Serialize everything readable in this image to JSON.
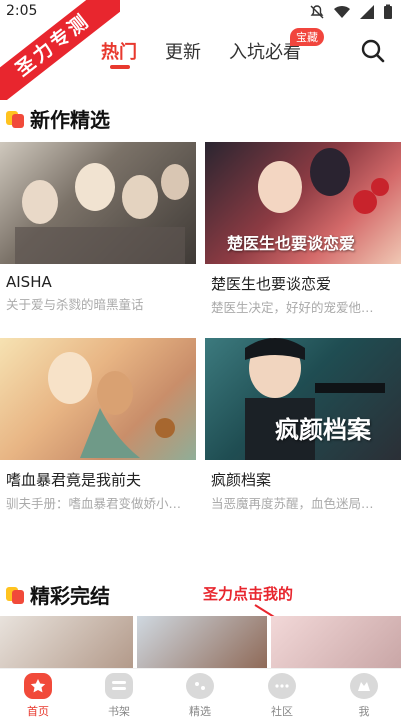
{
  "status": {
    "time": "2:05"
  },
  "ribbon": {
    "text": "圣力专测"
  },
  "topnav": {
    "tabs": [
      {
        "label": "热门",
        "active": true
      },
      {
        "label": "更新",
        "active": false
      },
      {
        "label": "入坑必看",
        "active": false,
        "badge": "宝藏"
      }
    ]
  },
  "section1": {
    "title": "新作精选",
    "items": [
      {
        "name": "AISHA",
        "desc": "关于爱与杀戮的暗黑童话"
      },
      {
        "name": "楚医生也要谈恋爱",
        "desc": "楚医生决定，好好的宠爱他…",
        "cover_text": "楚医生也要谈恋爱"
      },
      {
        "name": "嗜血暴君竟是我前夫",
        "desc": "驯夫手册：嗜血暴君变做娇小…"
      },
      {
        "name": "疯颜档案",
        "desc": "当恶魔再度苏醒，血色迷局…",
        "cover_text": "疯颜档案"
      }
    ]
  },
  "section2": {
    "title": "精彩完结"
  },
  "annotation": {
    "text": "圣力点击我的"
  },
  "bottomnav": {
    "items": [
      {
        "label": "首页",
        "icon": "home-star-icon",
        "active": true
      },
      {
        "label": "书架",
        "icon": "bookshelf-icon",
        "active": false
      },
      {
        "label": "精选",
        "icon": "featured-icon",
        "active": false
      },
      {
        "label": "社区",
        "icon": "community-chat-icon",
        "active": false
      },
      {
        "label": "我",
        "icon": "profile-icon",
        "active": false
      }
    ]
  },
  "colors": {
    "accent": "#e8392e",
    "ribbon": "#e8262e",
    "badge": "#f1453d"
  }
}
